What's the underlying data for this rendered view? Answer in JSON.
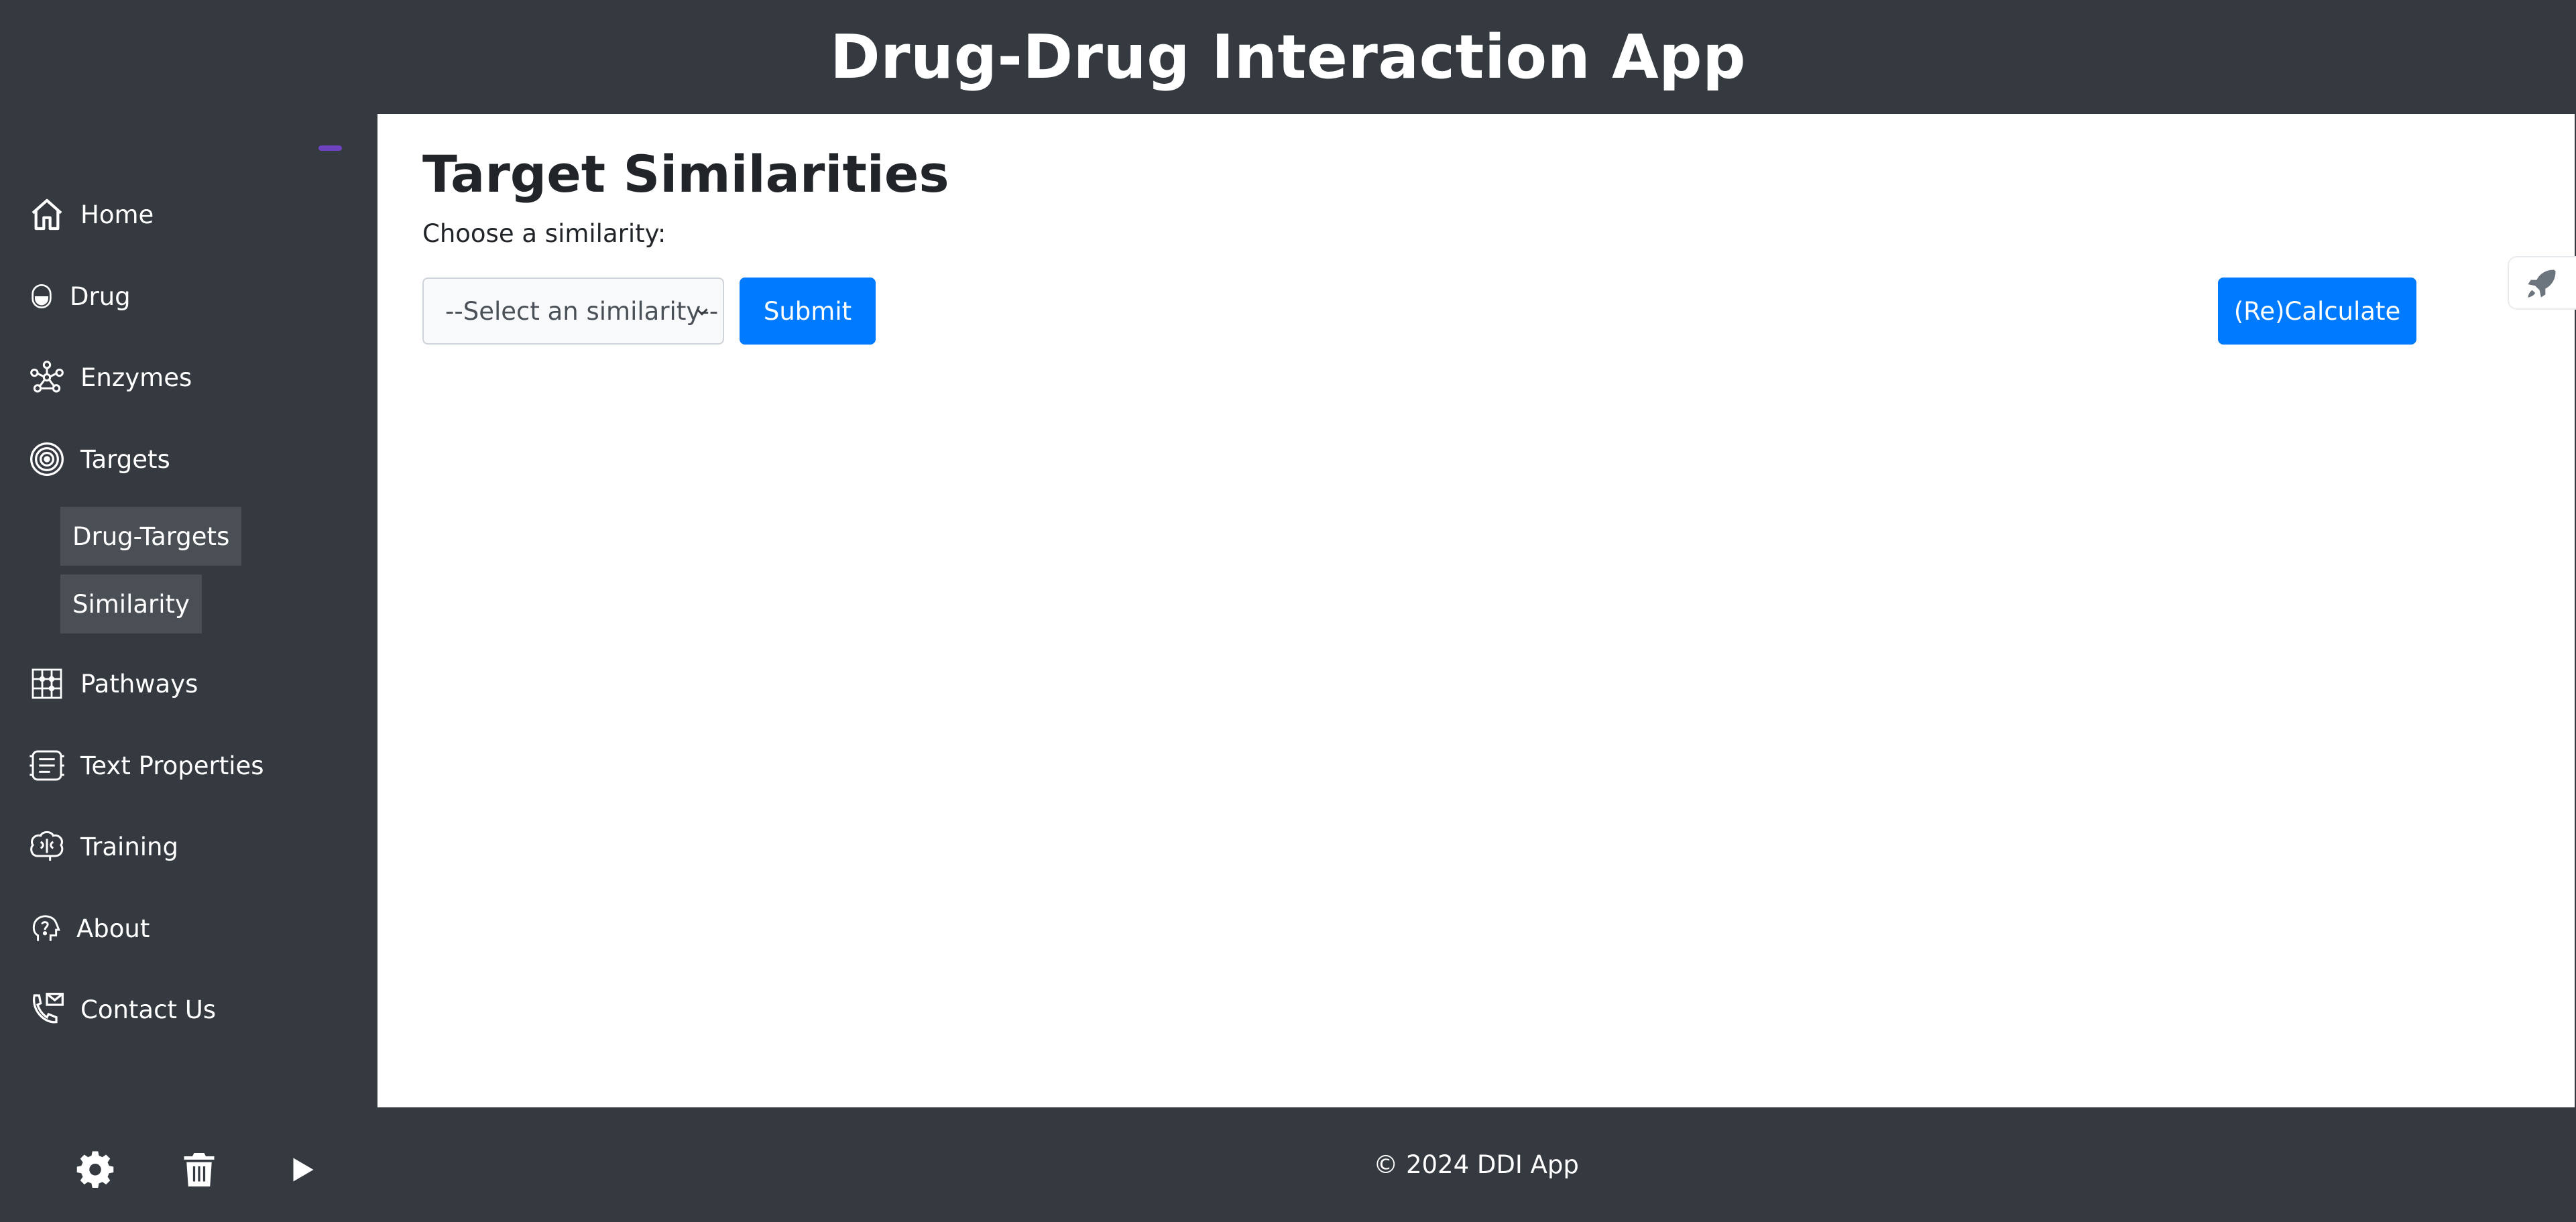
{
  "header": {
    "title": "Drug-Drug Interaction App"
  },
  "sidebar": {
    "items": [
      {
        "label": "Home",
        "icon": "home-icon"
      },
      {
        "label": "Drug",
        "icon": "pill-icon"
      },
      {
        "label": "Enzymes",
        "icon": "enzyme-network-icon"
      },
      {
        "label": "Targets",
        "icon": "target-icon"
      },
      {
        "label": "Pathways",
        "icon": "pathway-grid-icon"
      },
      {
        "label": "Text Properties",
        "icon": "text-circuit-icon"
      },
      {
        "label": "Training",
        "icon": "brain-icon"
      },
      {
        "label": "About",
        "icon": "question-head-icon"
      },
      {
        "label": "Contact Us",
        "icon": "phone-mail-icon"
      }
    ],
    "targets_subitems": [
      {
        "label": "Drug-Targets"
      },
      {
        "label": "Similarity"
      }
    ],
    "bottom_icons": [
      "gear-icon",
      "trash-icon",
      "play-icon"
    ]
  },
  "main": {
    "title": "Target Similarities",
    "choose_label": "Choose a similarity:",
    "select": {
      "selected": "--Select an similarity--"
    },
    "submit_label": "Submit",
    "recalc_label": "(Re)Calculate"
  },
  "footer": {
    "text": "© 2024 DDI App"
  },
  "colors": {
    "dark_bg": "#343a40",
    "primary": "#007bff",
    "accent": "#6f42c1",
    "subitem_bg": "#4a4f56"
  }
}
